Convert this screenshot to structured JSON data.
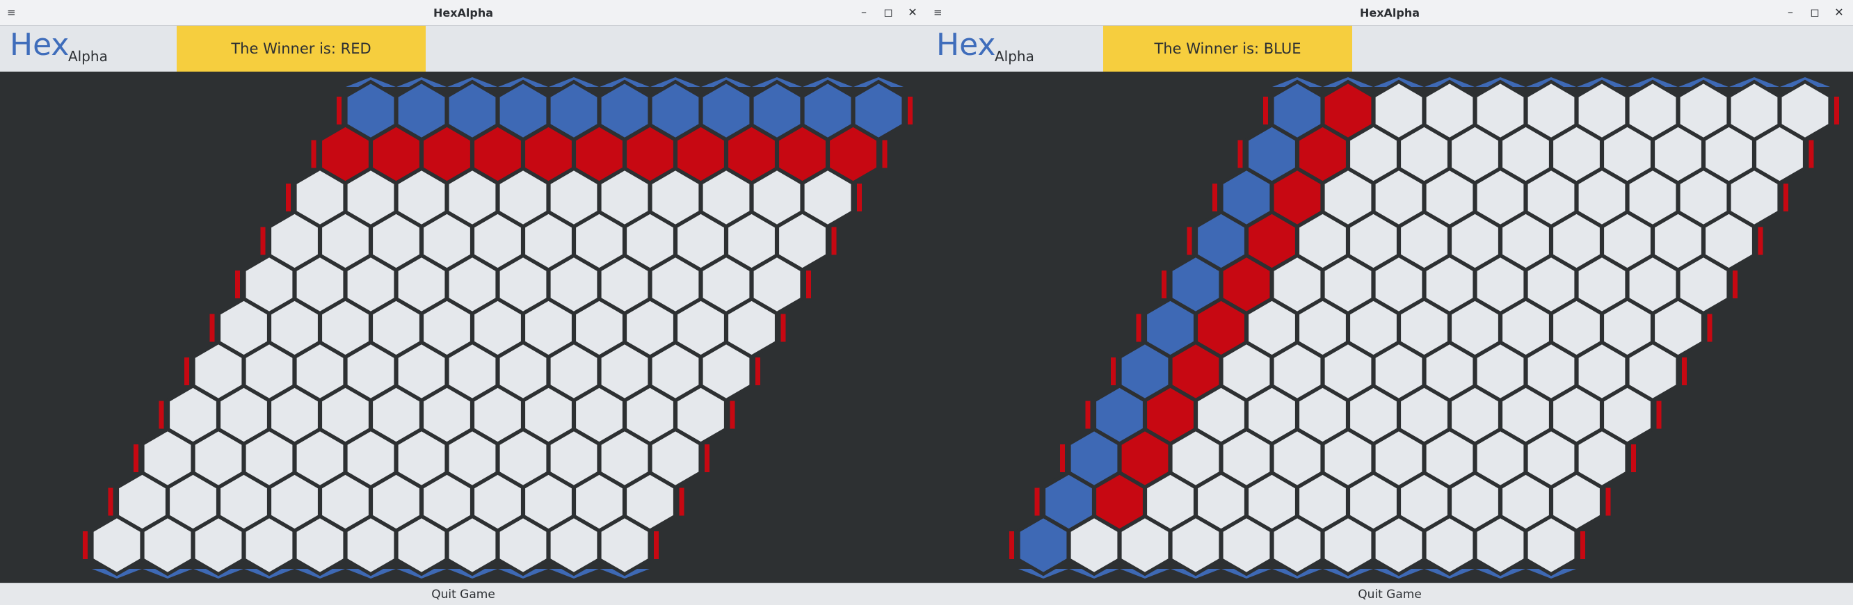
{
  "colors": {
    "red": "#c70812",
    "blue": "#3e69b5",
    "empty": "#e5e8ec",
    "outline": "#2d3032",
    "accent": "#f6ce3e"
  },
  "icons": {
    "menu": "hamburger-menu-icon",
    "minimize": "minimize-icon",
    "maximize": "maximize-icon",
    "close": "close-icon"
  },
  "windows": [
    {
      "title": "HexAlpha",
      "logo": {
        "main": "Hex",
        "sub": "Alpha"
      },
      "winner_text": "The Winner is: RED",
      "quit_label": "Quit Game",
      "board": {
        "size": 11,
        "rows": [
          "BBBBBBBBBBB",
          "RRRRRRRRRRR",
          "...........",
          "...........",
          "...........",
          "...........",
          "...........",
          "...........",
          "...........",
          "...........",
          "..........."
        ]
      }
    },
    {
      "title": "HexAlpha",
      "logo": {
        "main": "Hex",
        "sub": "Alpha"
      },
      "winner_text": "The Winner is: BLUE",
      "quit_label": "Quit Game",
      "board": {
        "size": 11,
        "rows": [
          "BR.........",
          "BR.........",
          "BR.........",
          "BR.........",
          "BR.........",
          "BR.........",
          "BR.........",
          "BR.........",
          "BR.........",
          "BR.........",
          "B.........."
        ]
      }
    }
  ]
}
